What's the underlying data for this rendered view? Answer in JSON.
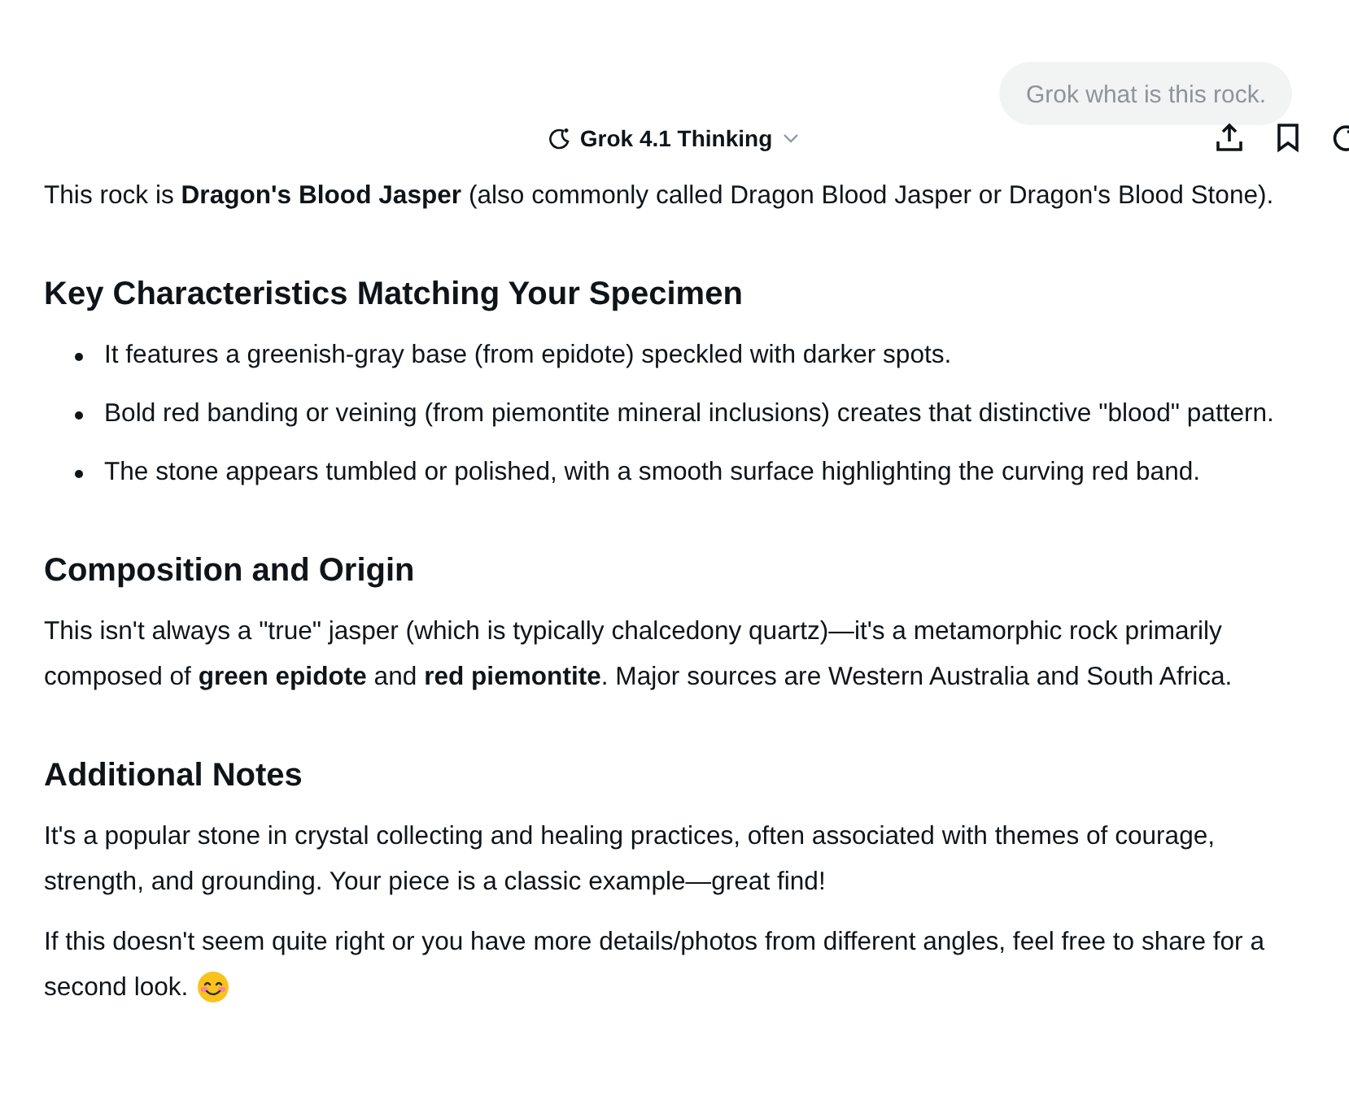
{
  "user_message": {
    "text": "Grok what is this rock."
  },
  "header": {
    "model": "Grok 4.1 Thinking"
  },
  "blocks": [
    {
      "kind": "paragraph",
      "text": "This rock is **Dragon's Blood Jasper** (also commonly called Dragon Blood Jasper or Dragon's Blood Stone)."
    },
    {
      "kind": "heading",
      "text": "Key Characteristics Matching Your Specimen"
    },
    {
      "kind": "list",
      "items": [
        "It features a greenish-gray base (from epidote) speckled with darker spots.",
        "Bold red banding or veining (from piemontite mineral inclusions) creates that distinctive \"blood\" pattern.",
        "The stone appears tumbled or polished, with a smooth surface highlighting the curving red band."
      ]
    },
    {
      "kind": "heading",
      "text": "Composition and Origin"
    },
    {
      "kind": "paragraph",
      "text": "This isn't always a \"true\" jasper (which is typically chalcedony quartz)—it's a metamorphic rock primarily composed of **green epidote** and **red piemontite**. Major sources are Western Australia and South Africa."
    },
    {
      "kind": "heading",
      "text": "Additional Notes"
    },
    {
      "kind": "paragraph",
      "text": "It's a popular stone in crystal collecting and healing practices, often associated with themes of courage, strength, and grounding. Your piece is a classic example—great find!"
    },
    {
      "kind": "paragraph",
      "text": "If this doesn't seem quite right or you have more details/photos from different angles, feel free to share for a second look.",
      "emoji": true
    }
  ]
}
